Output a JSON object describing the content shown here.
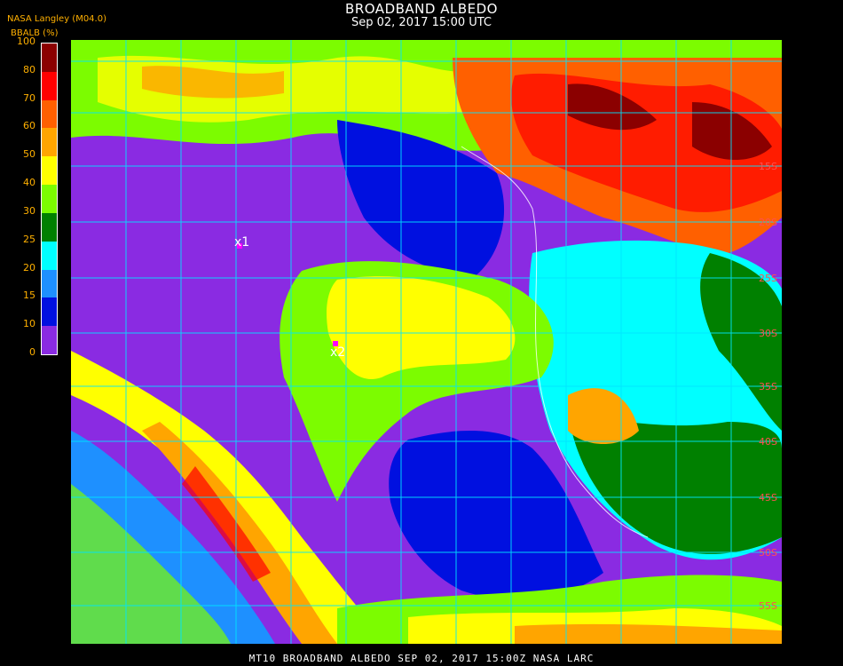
{
  "header": {
    "title": "BROADBAND ALBEDO",
    "datetime": "Sep 02, 2017 15:00 UTC",
    "source": "NASA Langley (M04.0)",
    "unit_label": "BBALB (%)"
  },
  "legend": {
    "ticks": [
      "100",
      "80",
      "70",
      "60",
      "50",
      "40",
      "30",
      "25",
      "20",
      "15",
      "10",
      "0"
    ],
    "bins": [
      {
        "from": 0,
        "to": 10,
        "color": "#8a2be2"
      },
      {
        "from": 10,
        "to": 15,
        "color": "#0010e0"
      },
      {
        "from": 15,
        "to": 20,
        "color": "#1e90ff"
      },
      {
        "from": 20,
        "to": 25,
        "color": "#00ffff"
      },
      {
        "from": 25,
        "to": 30,
        "color": "#008000"
      },
      {
        "from": 30,
        "to": 40,
        "color": "#7cfc00"
      },
      {
        "from": 40,
        "to": 50,
        "color": "#ffff00"
      },
      {
        "from": 50,
        "to": 60,
        "color": "#ffa500"
      },
      {
        "from": 60,
        "to": 70,
        "color": "#ff6000"
      },
      {
        "from": 70,
        "to": 80,
        "color": "#ff0000"
      },
      {
        "from": 80,
        "to": 100,
        "color": "#8b0000"
      }
    ]
  },
  "markers": [
    {
      "label": "x1",
      "color": "#ff00ff"
    },
    {
      "label": "x2",
      "color": "#ff00ff"
    }
  ],
  "grid_labels": [
    "15S",
    "20S",
    "25S",
    "30S",
    "35S",
    "40S",
    "45S",
    "50S",
    "55S"
  ],
  "footer": "MT10  BROADBAND ALBEDO   SEP 02, 2017 15:00Z   NASA LARC"
}
